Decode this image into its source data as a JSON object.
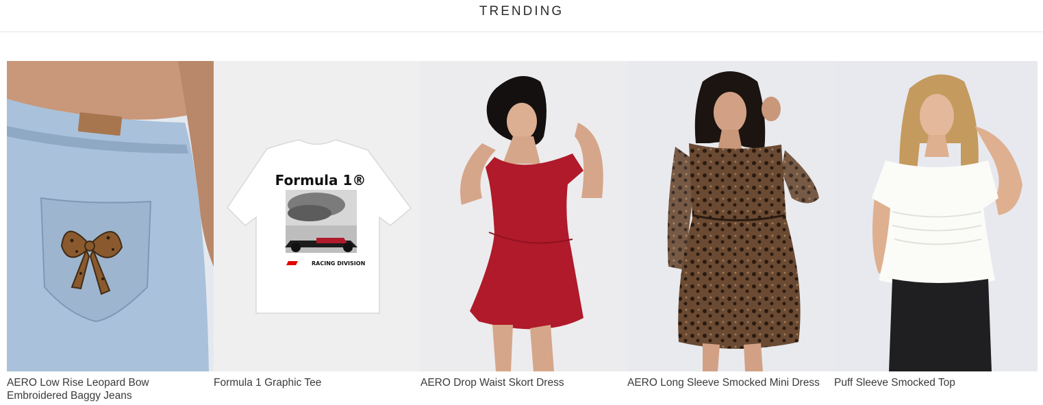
{
  "section": {
    "title": "TRENDING"
  },
  "products": [
    {
      "name": "AERO Low Rise Leopard Bow Embroidered Baggy Jeans",
      "image_bg": "#dfe6ef",
      "icon": "jeans-image"
    },
    {
      "name": "Formula 1 Graphic Tee",
      "image_bg": "#efeff0",
      "icon": "tee-image",
      "print_title": "Formula 1®",
      "print_sub": "RACING DIVISION"
    },
    {
      "name": "AERO Drop Waist Skort Dress",
      "image_bg": "#ececee",
      "icon": "dress-image"
    },
    {
      "name": "AERO Long Sleeve Smocked Mini Dress",
      "image_bg": "#e9eaee",
      "icon": "leopard-dress-image"
    },
    {
      "name": "Puff Sleeve Smocked Top",
      "image_bg": "#e7e9ef",
      "icon": "top-image"
    }
  ],
  "colors": {
    "dress_red": "#b01a2a",
    "denim": "#9fb8d3",
    "leopard": "#5a3d28"
  }
}
